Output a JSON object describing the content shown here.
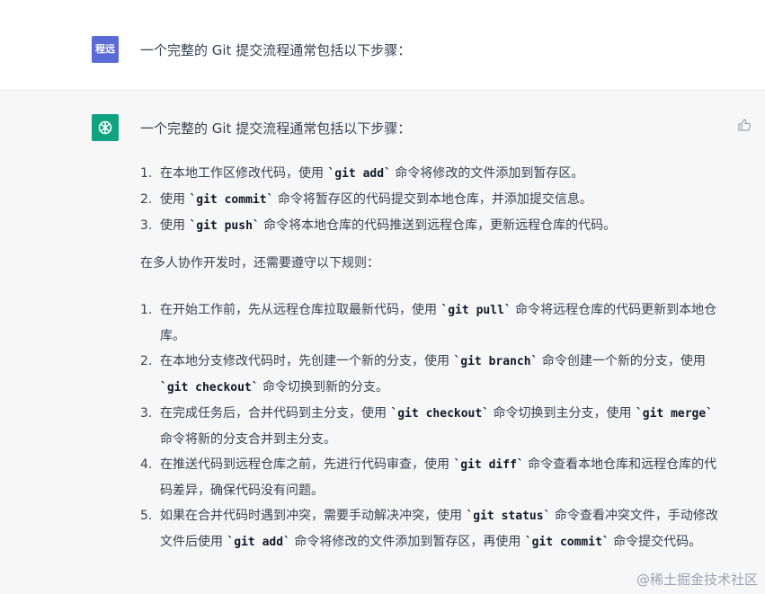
{
  "user": {
    "avatar_text": "程远",
    "message": "一个完整的 Git 提交流程通常包括以下步骤："
  },
  "bot": {
    "intro": "一个完整的 Git 提交流程通常包括以下步骤：",
    "steps": [
      {
        "num": "1.",
        "pre": "在本地工作区修改代码，使用 ",
        "code": "`git add`",
        "post": " 命令将修改的文件添加到暂存区。"
      },
      {
        "num": "2.",
        "pre": "使用 ",
        "code": "`git commit`",
        "post": " 命令将暂存区的代码提交到本地仓库，并添加提交信息。"
      },
      {
        "num": "3.",
        "pre": "使用 ",
        "code": "`git push`",
        "post": " 命令将本地仓库的代码推送到远程仓库，更新远程仓库的代码。"
      }
    ],
    "paragraph": "在多人协作开发时，还需要遵守以下规则：",
    "rules": [
      {
        "num": "1.",
        "pre": "在开始工作前，先从远程仓库拉取最新代码，使用 ",
        "code": "`git pull`",
        "post": " 命令将远程仓库的代码更新到本地仓库。"
      },
      {
        "num": "2.",
        "pre": "在本地分支修改代码时，先创建一个新的分支，使用 ",
        "code": "`git branch`",
        "mid": " 命令创建一个新的分支，使用 ",
        "code2": "`git checkout`",
        "post": " 命令切换到新的分支。"
      },
      {
        "num": "3.",
        "pre": "在完成任务后，合并代码到主分支，使用 ",
        "code": "`git checkout`",
        "mid": " 命令切换到主分支，使用 ",
        "code2": "`git merge`",
        "post": " 命令将新的分支合并到主分支。"
      },
      {
        "num": "4.",
        "pre": "在推送代码到远程仓库之前，先进行代码审查，使用 ",
        "code": "`git diff`",
        "post": " 命令查看本地仓库和远程仓库的代码差异，确保代码没有问题。"
      },
      {
        "num": "5.",
        "pre": "如果在合并代码时遇到冲突，需要手动解决冲突，使用 ",
        "code": "`git status`",
        "mid": " 命令查看冲突文件，手动修改文件后使用 ",
        "code2": "`git add`",
        "mid2": " 命令将修改的文件添加到暂存区，再使用 ",
        "code3": "`git commit`",
        "post": " 命令提交代码。"
      }
    ]
  },
  "watermark": "@稀土掘金技术社区",
  "icons": {
    "avatar_bot": "openai-logo-icon",
    "feedback": "thumbs-up-icon"
  },
  "colors": {
    "bot_avatar_bg": "#10a37f",
    "user_avatar_bg": "#5b6bd6",
    "bot_row_bg": "#f7f7f8"
  }
}
